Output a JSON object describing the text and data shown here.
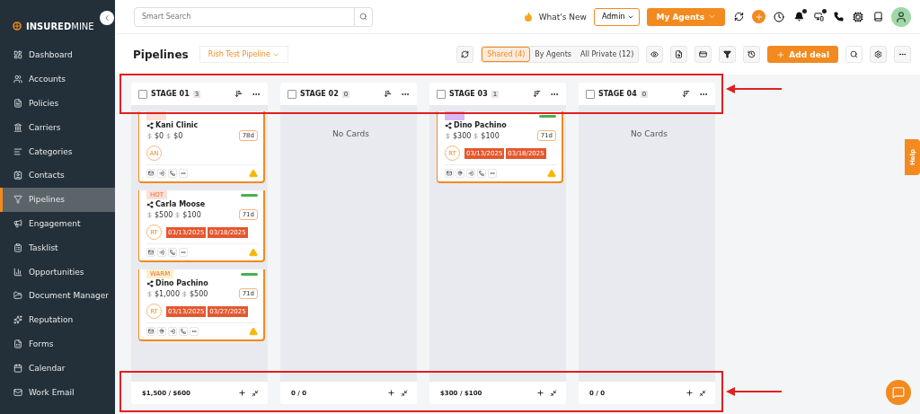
{
  "sidebar": {
    "logo": {
      "bold": "INSURED",
      "light": "MINE"
    },
    "items": [
      {
        "label": "Dashboard",
        "selected": false
      },
      {
        "label": "Accounts",
        "selected": false
      },
      {
        "label": "Policies",
        "selected": false
      },
      {
        "label": "Carriers",
        "selected": false
      },
      {
        "label": "Categories",
        "selected": false
      },
      {
        "label": "Contacts",
        "selected": false
      },
      {
        "label": "Pipelines",
        "selected": true
      },
      {
        "label": "Engagement",
        "selected": false
      },
      {
        "label": "Tasklist",
        "selected": false
      },
      {
        "label": "Opportunities",
        "selected": false
      },
      {
        "label": "Document Manager",
        "selected": false
      },
      {
        "label": "Reputation",
        "selected": false
      },
      {
        "label": "Forms",
        "selected": false
      },
      {
        "label": "Calendar",
        "selected": false
      },
      {
        "label": "Work Email",
        "selected": false
      }
    ]
  },
  "topbar": {
    "search": {
      "placeholder": "Smart Search"
    },
    "whats_new": "What's New",
    "role": "Admin",
    "agents_button": "My Agents"
  },
  "header": {
    "title": "Pipelines",
    "pipeline": "Rish Test Pipeline",
    "tabs": [
      {
        "label": "Shared (4)",
        "selected": true
      },
      {
        "label": "By Agents",
        "selected": false
      },
      {
        "label": "All Private (12)",
        "selected": false
      }
    ],
    "add_button": "Add deal"
  },
  "stages": [
    {
      "name": "STAGE 01",
      "count": "3",
      "checked": false,
      "total": "$1,500 / $600",
      "cards": [
        {
          "tag": {
            "color": "#fde0d6"
          },
          "flagged": false,
          "name": "Kani Clinic",
          "amount1": "$0",
          "amount2": "$0",
          "age": "78d",
          "initials": "AN",
          "actions": [
            {
              "kind": "mail"
            },
            {
              "kind": "login"
            },
            {
              "kind": "phone"
            },
            {
              "kind": "more"
            }
          ]
        },
        {
          "tag": {
            "label": "HOT",
            "color": "#fde0d6"
          },
          "flagged": true,
          "name": "Carla Moose",
          "amount1": "$500",
          "amount2": "$100",
          "age": "71d",
          "initials": "RT",
          "dates": [
            "03/13/2025",
            "03/18/2025"
          ],
          "actions": [
            {
              "kind": "mail"
            },
            {
              "kind": "login"
            },
            {
              "kind": "phone"
            },
            {
              "kind": "more"
            }
          ]
        },
        {
          "tag": {
            "label": "WARM",
            "color": "#fdf0c8"
          },
          "flagged": true,
          "name": "Dino Pachino",
          "amount1": "$1,000",
          "amount2": "$500",
          "age": "71d",
          "initials": "RT",
          "dates": [
            "03/13/2025",
            "03/27/2025"
          ],
          "actions": [
            {
              "kind": "mail"
            },
            {
              "kind": "pin"
            },
            {
              "kind": "login"
            },
            {
              "kind": "phone"
            },
            {
              "kind": "more"
            }
          ]
        }
      ]
    },
    {
      "name": "STAGE 02",
      "count": "0",
      "checked": false,
      "empty_text": "No Cards",
      "total": "0 / 0"
    },
    {
      "name": "STAGE 03",
      "count": "1",
      "checked": false,
      "total": "$300 / $100",
      "cards": [
        {
          "tag": {
            "color": "#d9b8f5"
          },
          "flagged": true,
          "name": "Dino Pachino",
          "amount1": "$300",
          "amount2": "$100",
          "age": "71d",
          "initials": "RT",
          "dates": [
            "03/13/2025",
            "03/18/2025"
          ],
          "actions": [
            {
              "kind": "mail"
            },
            {
              "kind": "pin"
            },
            {
              "kind": "login"
            },
            {
              "kind": "phone"
            },
            {
              "kind": "more"
            }
          ]
        }
      ]
    },
    {
      "name": "STAGE 04",
      "count": "0",
      "checked": false,
      "empty_text": "No Cards",
      "total": "0 / 0"
    }
  ],
  "help_tab": "Help"
}
